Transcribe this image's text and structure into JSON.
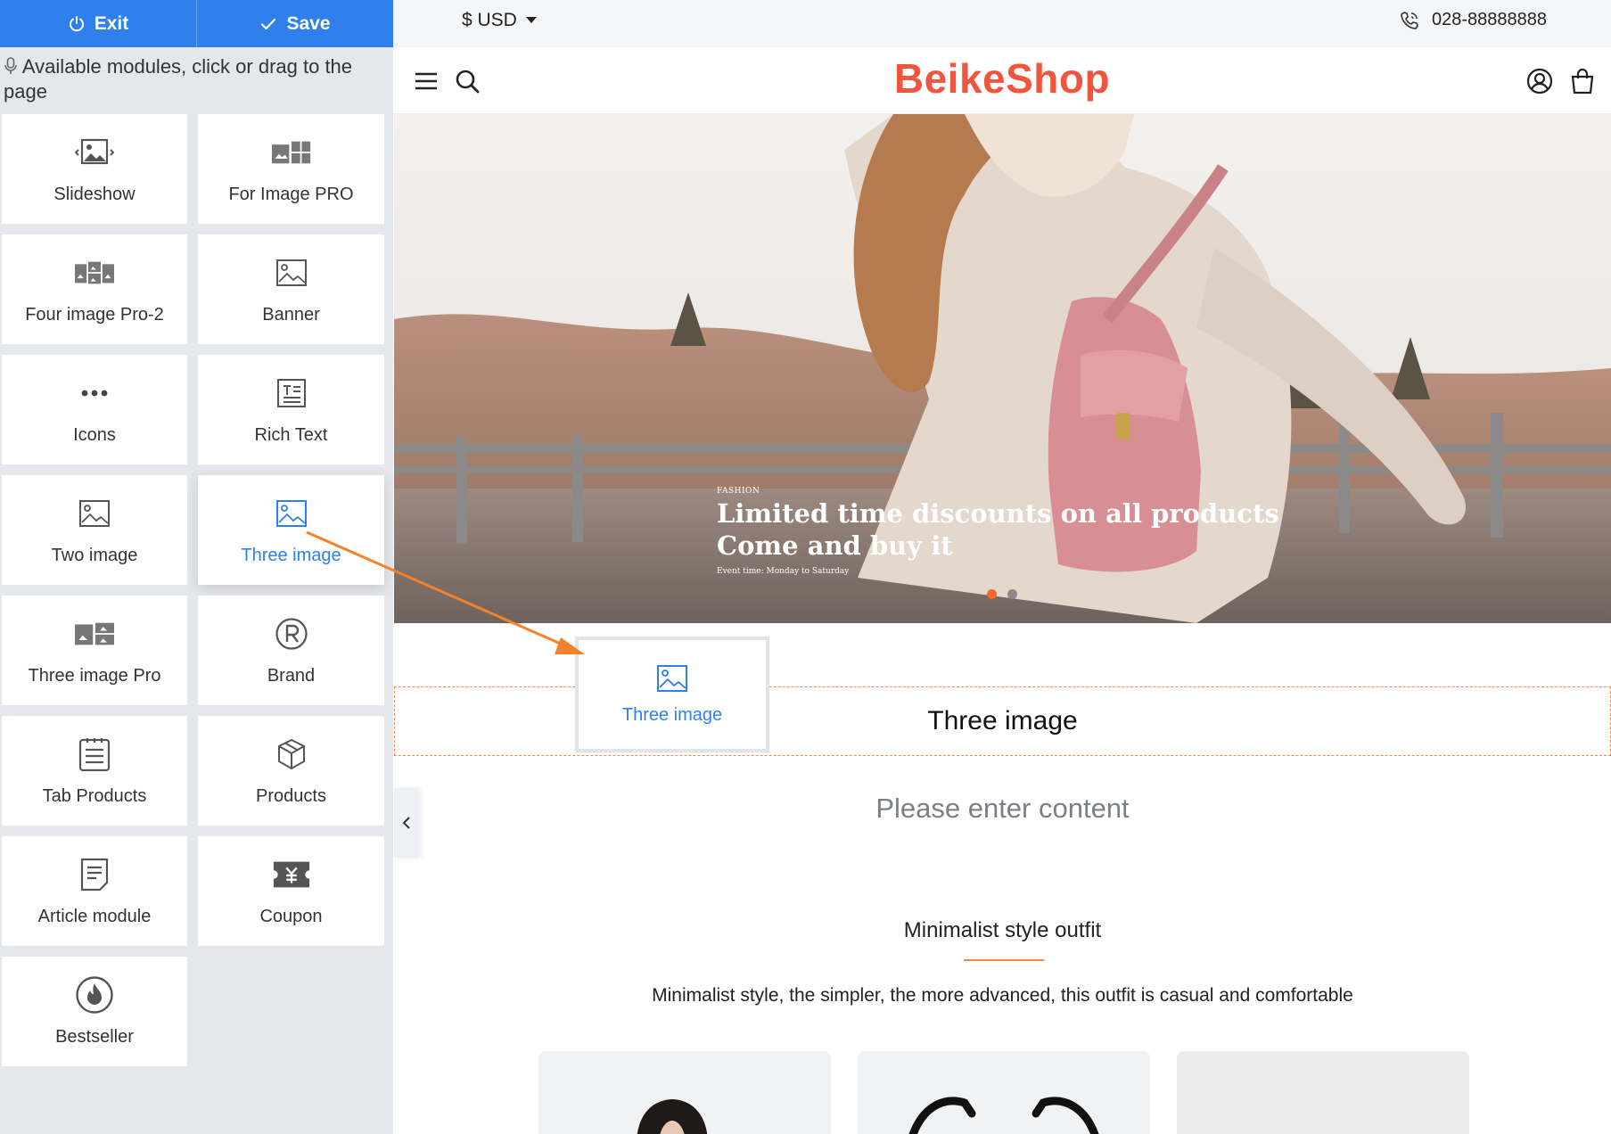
{
  "sidebar": {
    "exit_label": "Exit",
    "save_label": "Save",
    "hint": "Available modules, click or drag to the page",
    "modules": [
      {
        "label": "Slideshow",
        "icon": "slideshow-icon"
      },
      {
        "label": "For Image PRO",
        "icon": "image-pro-icon"
      },
      {
        "label": "Four image Pro-2",
        "icon": "four-image-icon"
      },
      {
        "label": "Banner",
        "icon": "banner-icon"
      },
      {
        "label": "Icons",
        "icon": "icons-icon"
      },
      {
        "label": "Rich Text",
        "icon": "rich-text-icon"
      },
      {
        "label": "Two image",
        "icon": "two-image-icon"
      },
      {
        "label": "Three image",
        "icon": "three-image-icon"
      },
      {
        "label": "Three image Pro",
        "icon": "three-image-pro-icon"
      },
      {
        "label": "Brand",
        "icon": "brand-icon"
      },
      {
        "label": "Tab Products",
        "icon": "tab-products-icon"
      },
      {
        "label": "Products",
        "icon": "products-icon"
      },
      {
        "label": "Article module",
        "icon": "article-icon"
      },
      {
        "label": "Coupon",
        "icon": "coupon-icon"
      },
      {
        "label": "Bestseller",
        "icon": "bestseller-icon"
      }
    ]
  },
  "store": {
    "currency": "$ USD",
    "phone": "028-88888888",
    "logo": "BeikeShop",
    "hero": {
      "tag": "FASHION",
      "title_line1": "Limited time discounts on all products",
      "title_line2": "Come and buy it",
      "subtitle": "Event time: Monday to Saturday"
    },
    "dropzone_label": "Three image",
    "dragging_label": "Three image",
    "placeholder": "Please enter content",
    "section_title": "Minimalist style outfit",
    "section_desc": "Minimalist style, the simpler, the more advanced, this outfit is casual and comfortable"
  },
  "colors": {
    "accent": "#2f80ed",
    "brand": "#f2553d",
    "drop_border": "#f08a55",
    "arrow": "#f5822a"
  }
}
